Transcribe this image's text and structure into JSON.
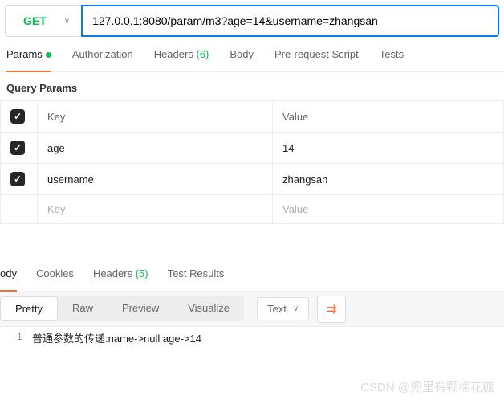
{
  "request": {
    "method": "GET",
    "url": "127.0.0.1:8080/param/m3?age=14&username=zhangsan"
  },
  "tabs": {
    "params": "Params",
    "auth": "Authorization",
    "headers": "Headers",
    "headers_count": "(6)",
    "body": "Body",
    "prereq": "Pre-request Script",
    "tests": "Tests"
  },
  "section_title": "Query Params",
  "table": {
    "header_key": "Key",
    "header_value": "Value",
    "rows": [
      {
        "key": "age",
        "value": "14"
      },
      {
        "key": "username",
        "value": "zhangsan"
      }
    ],
    "placeholder_key": "Key",
    "placeholder_value": "Value"
  },
  "resp_tabs": {
    "body": "ody",
    "cookies": "Cookies",
    "headers": "Headers",
    "headers_count": "(5)",
    "testres": "Test Results"
  },
  "view": {
    "pretty": "Pretty",
    "raw": "Raw",
    "preview": "Preview",
    "visualize": "Visualize",
    "format": "Text"
  },
  "response": {
    "line_no": "1",
    "body": "普通参数的传递:name->null age->14"
  },
  "watermark": "CSDN @兜里有颗棉花糖"
}
